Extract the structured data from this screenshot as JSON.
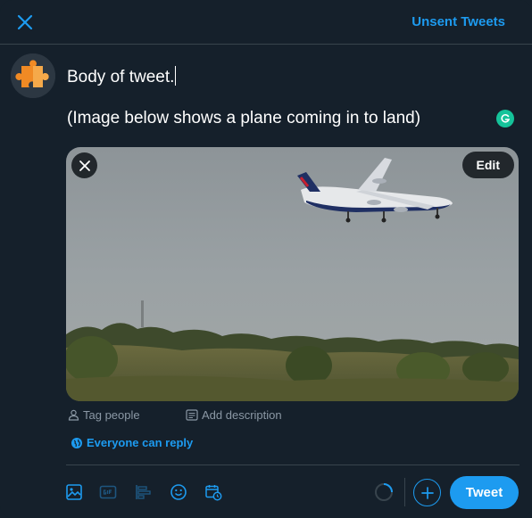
{
  "header": {
    "close_icon": "close-icon",
    "unsent_label": "Unsent Tweets"
  },
  "composer": {
    "line1": "Body of tweet.",
    "line2": "(Image below shows a plane coming in to land)"
  },
  "media": {
    "edit_label": "Edit",
    "tag_label": "Tag people",
    "description_label": "Add description"
  },
  "reply_setting": {
    "label": "Everyone can reply"
  },
  "toolbar": {
    "icons": [
      "image-icon",
      "gif-icon",
      "poll-icon",
      "emoji-icon",
      "schedule-icon"
    ],
    "tweet_label": "Tweet"
  },
  "colors": {
    "background": "#15202b",
    "accent": "#1d9bf0",
    "border": "#38444d",
    "muted_text": "#8b98a5"
  }
}
